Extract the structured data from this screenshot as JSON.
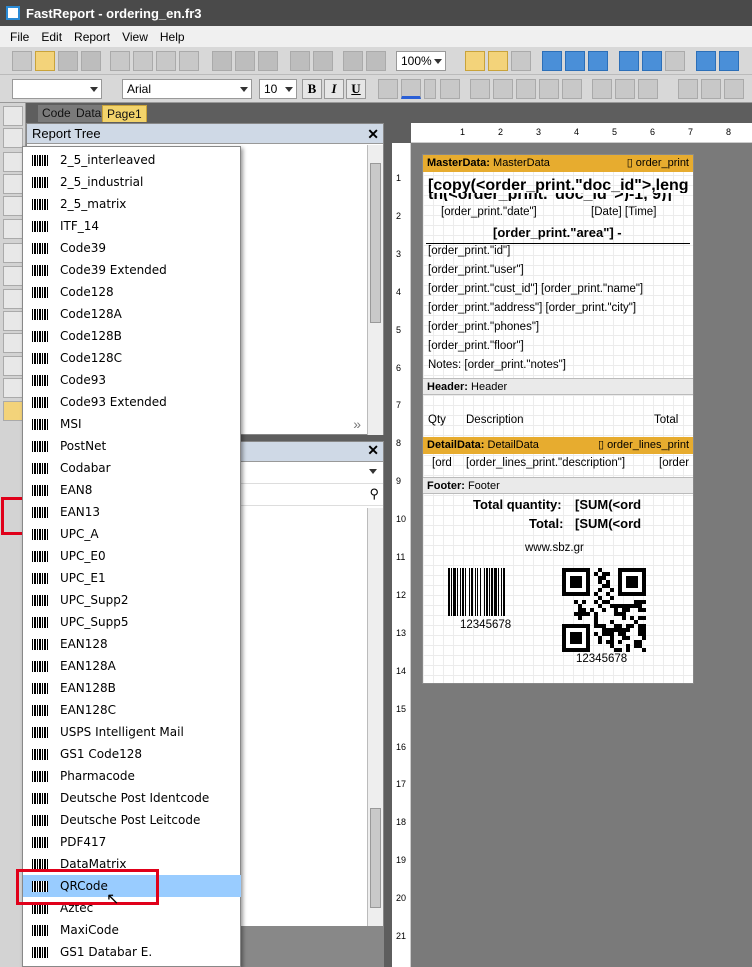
{
  "window": {
    "title": "FastReport - ordering_en.fr3"
  },
  "menu": [
    "File",
    "Edit",
    "Report",
    "View",
    "Help"
  ],
  "toolbar": {
    "zoom": "100%",
    "font_name": "Arial",
    "font_size": "10",
    "bold": "B",
    "italic": "I",
    "underline": "U"
  },
  "tabs": [
    {
      "label": "Code"
    },
    {
      "label": "Data"
    },
    {
      "label": "Page1"
    }
  ],
  "report_tree": {
    "title": "Report Tree"
  },
  "barcode_types": [
    "2_5_interleaved",
    "2_5_industrial",
    "2_5_matrix",
    "ITF_14",
    "Code39",
    "Code39 Extended",
    "Code128",
    "Code128A",
    "Code128B",
    "Code128C",
    "Code93",
    "Code93 Extended",
    "MSI",
    "PostNet",
    "Codabar",
    "EAN8",
    "EAN13",
    "UPC_A",
    "UPC_E0",
    "UPC_E1",
    "UPC_Supp2",
    "UPC_Supp5",
    "EAN128",
    "EAN128A",
    "EAN128B",
    "EAN128C",
    "USPS Intelligent Mail",
    "GS1 Code128",
    "Pharmacode",
    "Deutsche Post Identcode",
    "Deutsche Post Leitcode",
    "PDF417",
    "DataMatrix",
    "QRCode",
    "Aztec",
    "MaxiCode",
    "GS1 Databar E."
  ],
  "selected_barcode": "QRCode",
  "ruler_top": [
    "1",
    "2",
    "3",
    "4",
    "5",
    "6",
    "7",
    "8"
  ],
  "ruler_left": [
    "1",
    "2",
    "3",
    "4",
    "5",
    "6",
    "7",
    "8",
    "9",
    "10",
    "11",
    "12",
    "13",
    "14",
    "15",
    "16",
    "17",
    "18",
    "19",
    "20",
    "21"
  ],
  "report": {
    "masterdata": {
      "band_type": "MasterData:",
      "band_name": "MasterData",
      "source": "order_print"
    },
    "title_expr": "[copy(<order_print.\"doc_id\">,leng",
    "title_expr2": "th(<order_print.\"doc_id\">)-1, 9)]",
    "date_field": "[order_print.\"date\"]",
    "date_time": "[Date] [Time]",
    "area_field": "[order_print.\"area\"] -",
    "fields": [
      "[order_print.\"id\"]",
      "[order_print.\"user\"]",
      "[order_print.\"cust_id\"] [order_print.\"name\"]",
      "[order_print.\"address\"] [order_print.\"city\"]",
      "[order_print.\"phones\"]",
      "[order_print.\"floor\"]",
      "Notes: [order_print.\"notes\"]"
    ],
    "header": {
      "band_type": "Header:",
      "band_name": "Header",
      "qty": "Qty",
      "description": "Description",
      "total": "Total"
    },
    "detaildata": {
      "band_type": "DetailData:",
      "band_name": "DetailData",
      "source": "order_lines_print",
      "f1": "[ord",
      "f2": "[order_lines_print.\"description\"]",
      "f3": "[order"
    },
    "footer": {
      "band_type": "Footer:",
      "band_name": "Footer",
      "total_quantity_label": "Total quantity:",
      "total_quantity": "[SUM(<ord",
      "total_label": "Total:",
      "total": "[SUM(<ord",
      "website": "www.sbz.gr",
      "barcode_value": "12345678",
      "qr_value": "12345678"
    }
  },
  "colors": {
    "band_orange": "#e7ac2f",
    "highlight_red": "#e0001a",
    "selected_blue": "#99ccff"
  }
}
